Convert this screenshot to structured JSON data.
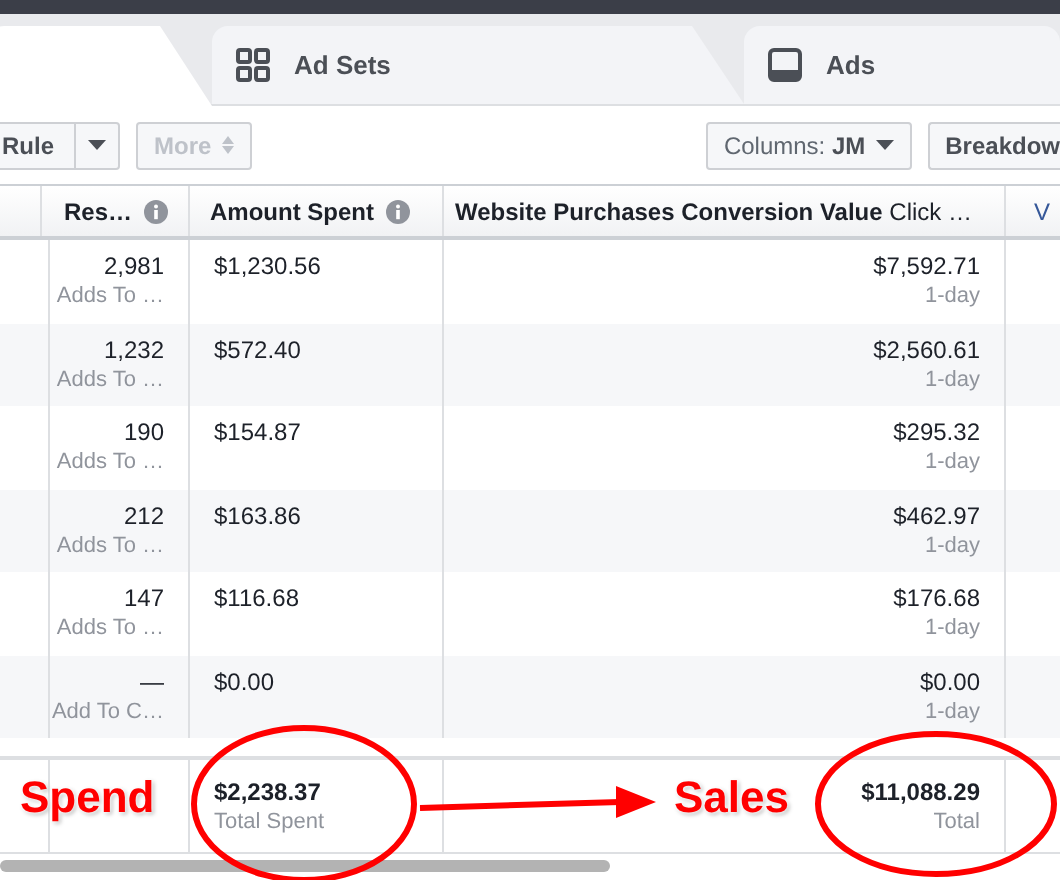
{
  "tabs": [
    {
      "selected": true
    },
    {
      "label": "Ad Sets",
      "selected": false
    },
    {
      "label": "Ads",
      "selected": false
    }
  ],
  "toolbar": {
    "left": [
      {
        "kind": "split",
        "label": "Rule",
        "disabled": false
      },
      {
        "kind": "button",
        "label": "More",
        "disabled": true
      }
    ],
    "right": [
      {
        "kind": "button",
        "label": "Columns: **JM**",
        "disabled": false
      },
      {
        "kind": "button",
        "label": "Breakdow",
        "disabled": false
      }
    ]
  },
  "table": {
    "columns": [
      {
        "kind": "blank"
      },
      {
        "kind": "metric",
        "label": "Res…"
      },
      {
        "kind": "metric",
        "label": "Amount Spent"
      },
      {
        "kind": "metric",
        "label": "**Website Purchases Conversion Value** Click …"
      },
      {
        "kind": "link",
        "label": "V"
      }
    ],
    "rows": [
      {
        "results": "2,981",
        "result_type": "Adds To …",
        "amount_spent": "$1,230.56",
        "conversion_value": "$7,592.71",
        "window": "1-day"
      },
      {
        "results": "1,232",
        "result_type": "Adds To …",
        "amount_spent": "$572.40",
        "conversion_value": "$2,560.61",
        "window": "1-day"
      },
      {
        "results": "190",
        "result_type": "Adds To …",
        "amount_spent": "$154.87",
        "conversion_value": "$295.32",
        "window": "1-day"
      },
      {
        "results": "212",
        "result_type": "Adds To …",
        "amount_spent": "$163.86",
        "conversion_value": "$462.97",
        "window": "1-day"
      },
      {
        "results": "147",
        "result_type": "Adds To …",
        "amount_spent": "$116.68",
        "conversion_value": "$176.68",
        "window": "1-day"
      },
      {
        "results": "—",
        "result_type": "Add To C…",
        "amount_spent": "$0.00",
        "conversion_value": "$0.00",
        "window": "1-day"
      }
    ],
    "totals": {
      "amount_spent": "$2,238.37",
      "amount_label": "Total Spent",
      "conversion_value": "$11,088.29",
      "conversion_label": "Total"
    }
  },
  "annotations": [
    {
      "kind": "label",
      "text": "Spend"
    },
    {
      "kind": "ellipse"
    },
    {
      "kind": "arrow"
    },
    {
      "kind": "label",
      "text": "Sales"
    },
    {
      "kind": "ellipse"
    }
  ]
}
